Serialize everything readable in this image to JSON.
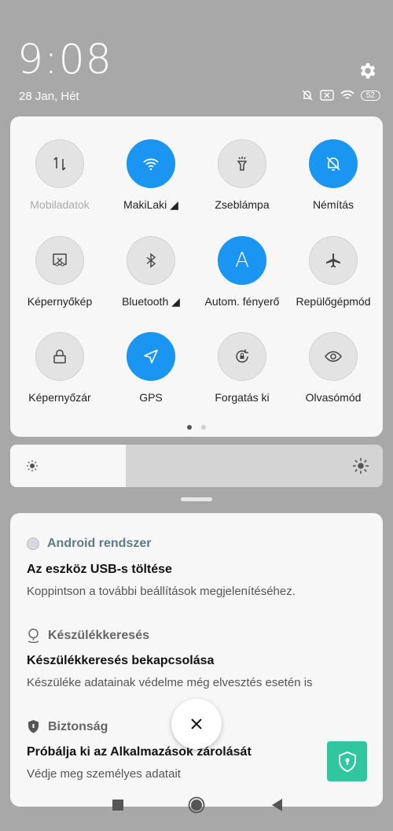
{
  "header": {
    "time": "9:08",
    "date": "28 Jan, Hét",
    "battery": "52"
  },
  "quick_settings": {
    "tiles": [
      {
        "label": "Mobiladatok",
        "icon": "mobile-data-icon",
        "active": false,
        "disabled": true
      },
      {
        "label": "MakiLaki ◢",
        "icon": "wifi-icon",
        "active": true
      },
      {
        "label": "Zseblámpa",
        "icon": "flashlight-icon",
        "active": false
      },
      {
        "label": "Némítás",
        "icon": "bell-off-icon",
        "active": true
      },
      {
        "label": "Képernyőkép",
        "icon": "screenshot-icon",
        "active": false
      },
      {
        "label": "Bluetooth ◢",
        "icon": "bluetooth-icon",
        "active": false
      },
      {
        "label": "Autom. fényerő",
        "icon": "auto-brightness-icon",
        "active": true
      },
      {
        "label": "Repülőgépmód",
        "icon": "airplane-icon",
        "active": false
      },
      {
        "label": "Képernyőzár",
        "icon": "lock-icon",
        "active": false
      },
      {
        "label": "GPS",
        "icon": "gps-icon",
        "active": true
      },
      {
        "label": "Forgatás ki",
        "icon": "rotation-lock-icon",
        "active": false
      },
      {
        "label": "Olvasómód",
        "icon": "eye-icon",
        "active": false
      }
    ],
    "page": 1,
    "pages": 2,
    "auto_letter": "A"
  },
  "brightness": {
    "level": 0.31
  },
  "notifications": [
    {
      "app": "Android rendszer",
      "title": "Az eszköz USB-s töltése",
      "body": "Koppintson a további beállítások megjelenítéséhez."
    },
    {
      "app": "Készülékkeresés",
      "title": "Készülékkeresés bekapcsolása",
      "body": "Készüléke adatainak védelme még elvesztés esetén is"
    },
    {
      "app": "Biztonság",
      "title": "Próbálja ki az Alkalmazások zárolását",
      "body": "Védje meg személyes adatait"
    }
  ],
  "colors": {
    "accent": "#1a95f2",
    "security": "#2fc6a0"
  }
}
